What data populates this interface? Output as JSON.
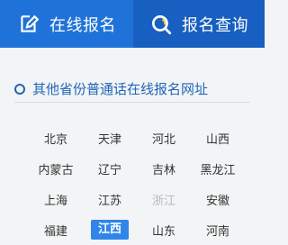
{
  "tabs": {
    "online": {
      "label": "在线报名",
      "icon": "edit-icon",
      "bg": "#1f73d8"
    },
    "query": {
      "label": "报名查询",
      "icon": "search-icon",
      "bg": "#175fc0"
    }
  },
  "section": {
    "title": "其他省份普通话在线报名网址",
    "accent": "#1f66b8"
  },
  "provinces": [
    [
      "北京",
      "天津",
      "河北",
      "山西"
    ],
    [
      "内蒙古",
      "辽宁",
      "吉林",
      "黑龙江"
    ],
    [
      "上海",
      "江苏",
      "浙江",
      "安徽"
    ],
    [
      "福建",
      "江西",
      "山东",
      "河南"
    ]
  ],
  "selected": "江西",
  "muted": [
    "浙江"
  ]
}
